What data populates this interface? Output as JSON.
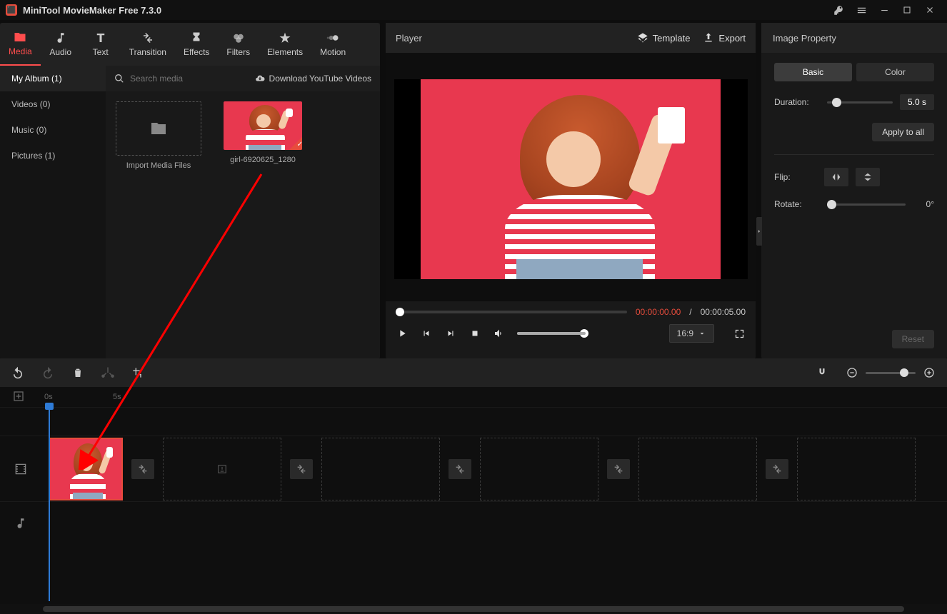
{
  "app": {
    "title": "MiniTool MovieMaker Free 7.3.0"
  },
  "toolbar": {
    "media": "Media",
    "audio": "Audio",
    "text": "Text",
    "transition": "Transition",
    "effects": "Effects",
    "filters": "Filters",
    "elements": "Elements",
    "motion": "Motion"
  },
  "sidebar": {
    "my_album": "My Album (1)",
    "videos": "Videos (0)",
    "music": "Music (0)",
    "pictures": "Pictures (1)"
  },
  "media": {
    "search_placeholder": "Search media",
    "download": "Download YouTube Videos",
    "import_label": "Import Media Files",
    "clip1_name": "girl-6920625_1280"
  },
  "player": {
    "title": "Player",
    "template": "Template",
    "export": "Export",
    "time_current": "00:00:00.00",
    "time_sep": "/",
    "time_total": "00:00:05.00",
    "aspect": "16:9"
  },
  "props": {
    "title": "Image Property",
    "tab_basic": "Basic",
    "tab_color": "Color",
    "duration_lbl": "Duration:",
    "duration_val": "5.0 s",
    "apply": "Apply to all",
    "flip_lbl": "Flip:",
    "rotate_lbl": "Rotate:",
    "rotate_val": "0°",
    "reset": "Reset"
  },
  "ruler": {
    "mark0": "0s",
    "mark5": "5s"
  }
}
